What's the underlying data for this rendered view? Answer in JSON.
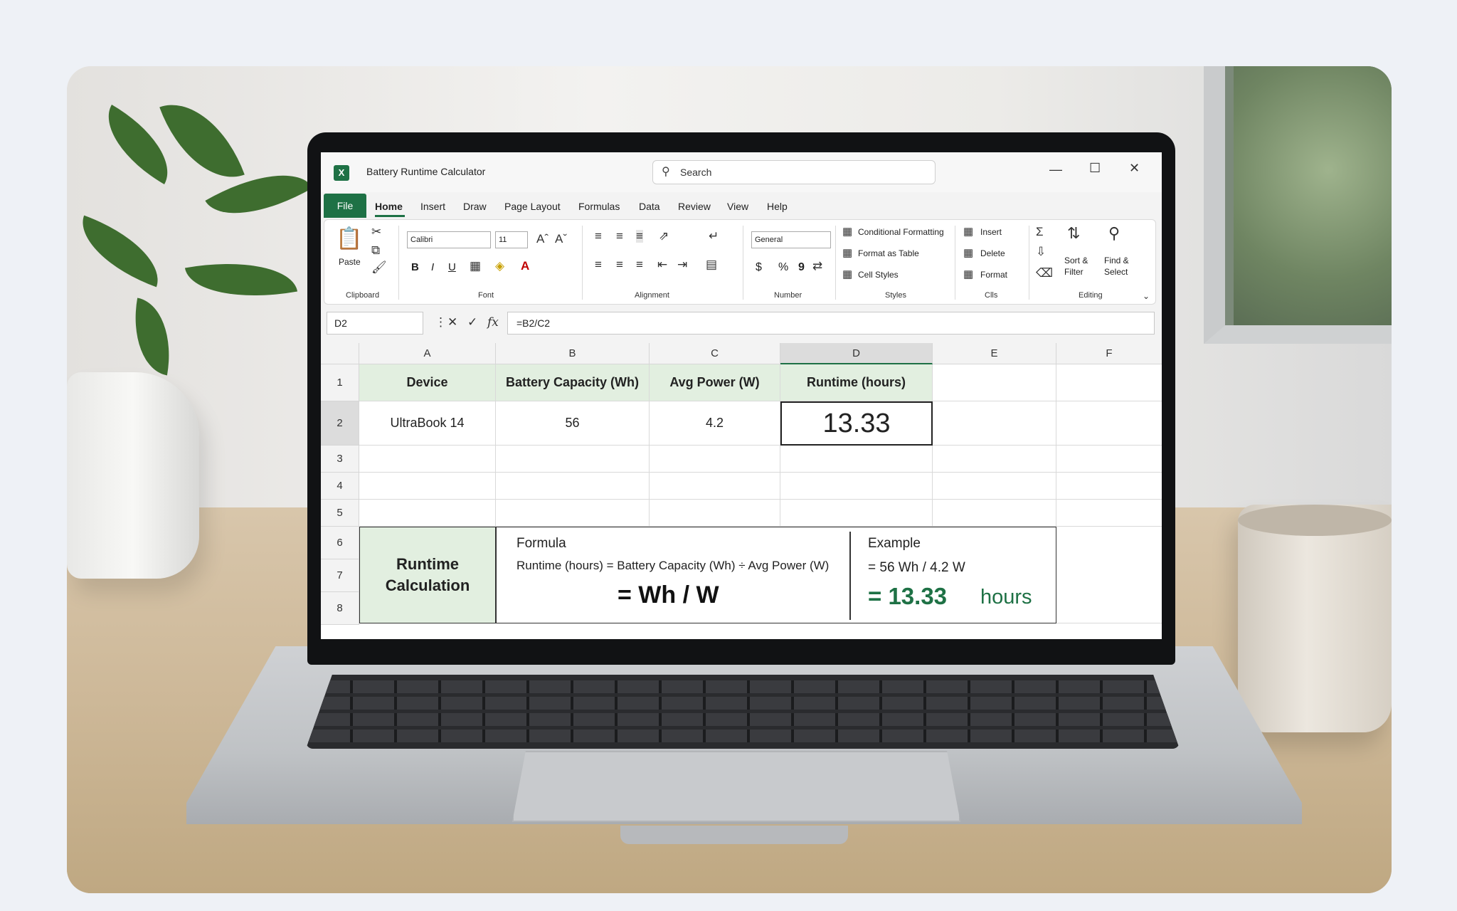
{
  "app": {
    "title": "Battery Runtime Calculator",
    "logo_letter": "X",
    "accent": "#1e7145"
  },
  "search": {
    "label": "Search"
  },
  "menu": {
    "file": "File",
    "items": [
      "Home",
      "Insert",
      "Draw",
      "Page Layout",
      "Formulas",
      "Data",
      "Review",
      "View",
      "Help"
    ]
  },
  "ribbon": {
    "clipboard": {
      "paste": "Paste",
      "group": "Clipboard"
    },
    "font": {
      "name": "Calibri",
      "size": "11",
      "bold": "B",
      "italic": "I",
      "underline": "U",
      "grow": "A^",
      "shrink": "A",
      "group": "Font"
    },
    "alignment": {
      "group": "Alignment"
    },
    "number": {
      "format": "General",
      "currency": "$",
      "percent": "%",
      "comma": "9",
      "group": "Number"
    },
    "styles": {
      "conditional": "Conditional Formatting",
      "format_table": "Format as Table",
      "cell_styles": "Cell Styles",
      "group": "Styles"
    },
    "cells": {
      "insert": "Insert",
      "delete": "Delete",
      "format": "Format",
      "group": "Clls"
    },
    "editing": {
      "sort1": "Sort &",
      "sort2": "Filter",
      "find1": "Find &",
      "find2": "Select",
      "group": "Editing"
    }
  },
  "formula_bar": {
    "name_box": "D2",
    "fx": "fx",
    "formula": "=B2/C2"
  },
  "sheet": {
    "columns": [
      "A",
      "B",
      "C",
      "D",
      "E",
      "F"
    ],
    "rows": [
      "1",
      "2",
      "3",
      "4",
      "5",
      "6",
      "7",
      "8"
    ],
    "headers": [
      "Device",
      "Battery Capacity (Wh)",
      "Avg Power (W)",
      "Runtime (hours)"
    ],
    "row2": [
      "UltraBook 14",
      "56",
      "4.2",
      "13.33"
    ],
    "calc_label_1": "Runtime",
    "calc_label_2": "Calculation",
    "formula_title": "Formula",
    "formula_text": "Runtime (hours) = Battery Capacity (Wh) ÷ Avg Power (W)",
    "formula_big": "= Wh / W",
    "example_title": "Example",
    "example_line": "= 56 Wh / 4.2 W",
    "example_result_prefix": "= 13.33",
    "example_result_unit": "hours"
  }
}
